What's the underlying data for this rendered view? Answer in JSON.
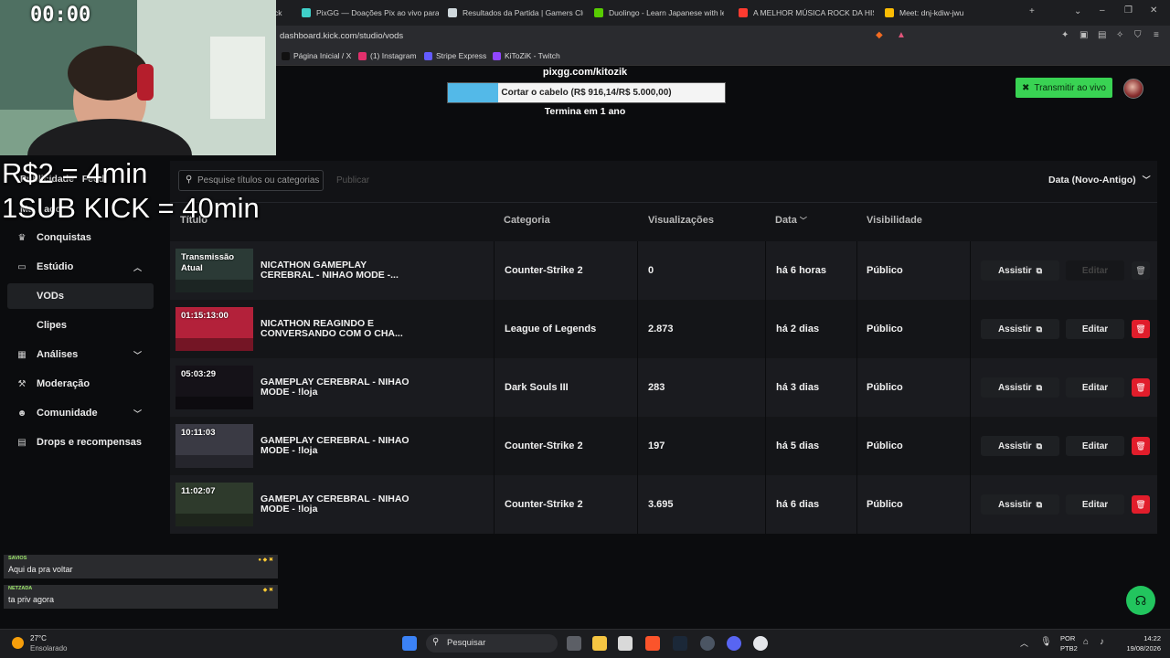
{
  "browser": {
    "tabs": [
      {
        "title": "ck",
        "color": "#53fc18"
      },
      {
        "title": "PixGG — Doações Pix ao vivo para",
        "color": "#3fd0c9"
      },
      {
        "title": "Resultados da Partida | Gamers Club",
        "color": "#cfd8dc"
      },
      {
        "title": "Duolingo - Learn Japanese with less",
        "color": "#58cc02"
      },
      {
        "title": "A MELHOR MÚSICA ROCK DA HISTÓ",
        "color": "#ff3b30"
      },
      {
        "title": "Meet: dnj-kdiw-jwu",
        "color": "#fbbc04"
      }
    ],
    "new_tab": "+",
    "url": "dashboard.kick.com/studio/vods",
    "bookmarks": [
      {
        "label": "Página Inicial / X",
        "color": "#111111"
      },
      {
        "label": "(1) Instagram",
        "color": "#e1306c"
      },
      {
        "label": "Stripe Express",
        "color": "#635bff"
      },
      {
        "label": "KiToZiK - Twitch",
        "color": "#9146ff"
      }
    ]
  },
  "goal": {
    "url": "pixgg.com/kitozik",
    "text": "Cortar o cabelo (R$ 916,14/R$ 5.000,00)",
    "progress": 0.183,
    "ends": "Termina em 1 ano"
  },
  "header": {
    "live_button": "Transmitir ao vivo"
  },
  "overlay": {
    "timer": "00:00",
    "line1": "R$2 = 4min",
    "line2": "1SUB KICK = 40min",
    "chat": [
      {
        "user": "SAVIOS",
        "message": "Aqui da pra voltar"
      },
      {
        "user": "NETZADA",
        "message": "ta priv agora"
      }
    ]
  },
  "sidebar": {
    "hidden_item_1": "Publicidade",
    "hidden_item_1b": "Feed",
    "hidden_item_2": "Ma",
    "hidden_item_2b": "ado",
    "items": [
      {
        "label": "Conquistas",
        "icon": "trophy-icon"
      },
      {
        "label": "Estúdio",
        "icon": "studio-icon",
        "expanded": true
      },
      {
        "label": "VODs",
        "active": true
      },
      {
        "label": "Clipes"
      },
      {
        "label": "Análises",
        "icon": "chart-icon",
        "expandable": true
      },
      {
        "label": "Moderação",
        "icon": "hammer-icon"
      },
      {
        "label": "Comunidade",
        "icon": "people-icon",
        "expandable": true
      },
      {
        "label": "Drops e recompensas",
        "icon": "gift-icon"
      }
    ]
  },
  "toolbar": {
    "search_placeholder": "Pesquise títulos ou categorias",
    "publish_label": "Publicar",
    "sort_label": "Data (Novo-Antigo)"
  },
  "table": {
    "headers": {
      "title": "Título",
      "category": "Categoria",
      "views": "Visualizações",
      "date": "Data",
      "visibility": "Visibilidade"
    },
    "watch_label": "Assistir",
    "edit_label": "Editar",
    "rows": [
      {
        "duration": "Transmissão Atual",
        "title": "NICATHON GAMEPLAY CEREBRAL - NIHAO MODE -...",
        "category": "Counter-Strike 2",
        "views": "0",
        "date": "há 6 horas",
        "visibility": "Público",
        "editable": false,
        "thumb_color": "#2b3a36"
      },
      {
        "duration": "01:15:13:00",
        "title": "NICATHON REAGINDO E CONVERSANDO COM O CHA...",
        "category": "League of Legends",
        "views": "2.873",
        "date": "há 2 dias",
        "visibility": "Público",
        "editable": true,
        "thumb_color": "#b3213a"
      },
      {
        "duration": "05:03:29",
        "title": "GAMEPLAY CEREBRAL - NIHAO MODE - !loja",
        "category": "Dark Souls III",
        "views": "283",
        "date": "há 3 dias",
        "visibility": "Público",
        "editable": true,
        "thumb_color": "#151218"
      },
      {
        "duration": "10:11:03",
        "title": "GAMEPLAY CEREBRAL - NIHAO MODE - !loja",
        "category": "Counter-Strike 2",
        "views": "197",
        "date": "há 5 dias",
        "visibility": "Público",
        "editable": true,
        "thumb_color": "#3a3a44"
      },
      {
        "duration": "11:02:07",
        "title": "GAMEPLAY CEREBRAL - NIHAO MODE - !loja",
        "category": "Counter-Strike 2",
        "views": "3.695",
        "date": "há 6 dias",
        "visibility": "Público",
        "editable": true,
        "thumb_color": "#2e3a2c"
      }
    ]
  },
  "taskbar": {
    "weather_temp": "27°C",
    "weather_desc": "Ensolarado",
    "search_label": "Pesquisar",
    "lang": "POR",
    "lang2": "PTB2",
    "time": "14:22",
    "date": "19/08/2026"
  }
}
